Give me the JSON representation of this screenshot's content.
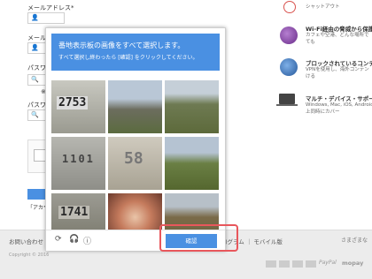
{
  "form": {
    "email_label": "メールアドレス*",
    "email_label2": "メールア",
    "password_label": "パスワー",
    "password_label2": "パスワー",
    "note": "※",
    "account_link": "「アカウン"
  },
  "right_panel": [
    {
      "title": "",
      "desc": "シャットアウト",
      "icon": "block-icon"
    },
    {
      "title": "Wi-Fi経由の脅威から保護",
      "desc1": "カフェや空港、どんな場所で",
      "desc2": "ても",
      "icon": "wifi-shield-icon"
    },
    {
      "title": "ブロックされているコンテン",
      "desc1": "VPNを使用し、海外コンテン",
      "desc2": "ける",
      "icon": "globe-icon"
    },
    {
      "title": "マルチ・デバイス・サポート",
      "desc1": "Windows, Mac, iOS, Android",
      "desc2": "上同時にカバー",
      "icon": "devices-icon"
    }
  ],
  "footer": {
    "contact": "お問い合わせ",
    "copyright": "Copyright © 2016",
    "links": "ログラム ｜ モバイル版",
    "payment_text": "さまざまな",
    "cards": [
      "AMEX",
      "VISA",
      "MC",
      "JCB",
      "PayPal",
      "mopay"
    ]
  },
  "captcha": {
    "title": "番地表示板の画像をすべて選択します。",
    "subtitle": "すべて選択し終わったら [確認] をクリックしてください。",
    "tiles": [
      {
        "label": "2753",
        "kind": "number-plate"
      },
      {
        "label": "",
        "kind": "mountain"
      },
      {
        "label": "",
        "kind": "hills"
      },
      {
        "label": "1101",
        "kind": "number-plate"
      },
      {
        "label": "58",
        "kind": "number-plate"
      },
      {
        "label": "",
        "kind": "grass"
      },
      {
        "label": "1741",
        "kind": "number-plate"
      },
      {
        "label": "",
        "kind": "ornament"
      },
      {
        "label": "",
        "kind": "field"
      }
    ],
    "verify_label": "確認",
    "reload_icon": "reload-icon",
    "audio_icon": "headphones-icon",
    "info_icon": "info-icon"
  },
  "colors": {
    "accent": "#4a90e2",
    "highlight": "#e8575c"
  }
}
